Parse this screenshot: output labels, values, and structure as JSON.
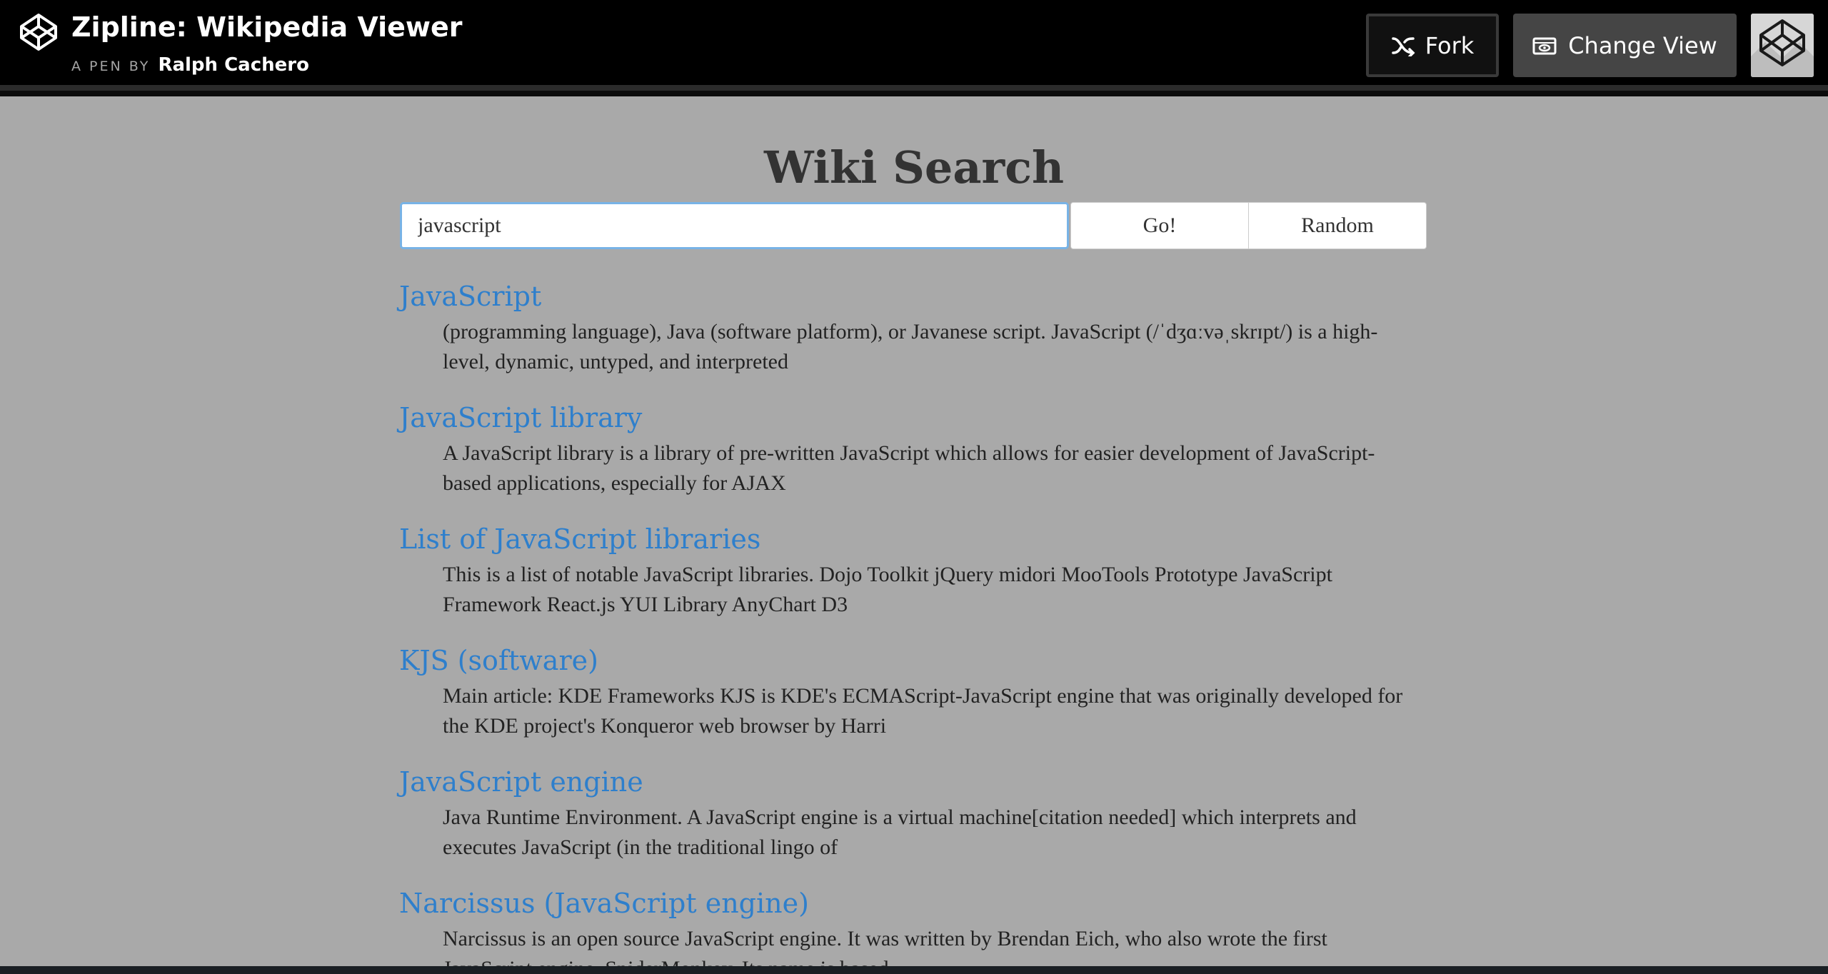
{
  "header": {
    "pen_title": "Zipline: Wikipedia Viewer",
    "pen_by_label": "A PEN BY",
    "author": "Ralph Cachero",
    "fork_label": "Fork",
    "change_view_label": "Change View"
  },
  "main": {
    "heading": "Wiki Search",
    "search": {
      "value": "javascript",
      "placeholder": ""
    },
    "go_label": "Go!",
    "random_label": "Random"
  },
  "results": [
    {
      "title": "JavaScript",
      "snippet": "(programming language), Java (software platform), or Javanese script. JavaScript (/ˈdʒɑːvəˌskrɪpt/) is a high-level, dynamic, untyped, and interpreted"
    },
    {
      "title": "JavaScript library",
      "snippet": "A JavaScript library is a library of pre-written JavaScript which allows for easier development of JavaScript-based applications, especially for AJAX"
    },
    {
      "title": "List of JavaScript libraries",
      "snippet": "This is a list of notable JavaScript libraries. Dojo Toolkit jQuery midori MooTools Prototype JavaScript Framework React.js YUI Library AnyChart D3"
    },
    {
      "title": "KJS (software)",
      "snippet": "Main article: KDE Frameworks KJS is KDE's ECMAScript-JavaScript engine that was originally developed for the KDE project's Konqueror web browser by Harri"
    },
    {
      "title": "JavaScript engine",
      "snippet": "Java Runtime Environment. A JavaScript engine is a virtual machine[citation needed] which interprets and executes JavaScript (in the traditional lingo of"
    },
    {
      "title": "Narcissus (JavaScript engine)",
      "snippet": "Narcissus is an open source JavaScript engine. It was written by Brendan Eich, who also wrote the first JavaScript engine, SpiderMonkey. Its name is based"
    }
  ],
  "colors": {
    "topbar": "#000000",
    "preview_bg": "#a9a9a9",
    "link": "#2e7fcc",
    "input_focus": "#78b3e6"
  },
  "icons": {
    "logo": "codepen-logo-icon",
    "fork": "fork-icon",
    "change_view": "change-view-icon",
    "avatar": "codepen-avatar"
  }
}
